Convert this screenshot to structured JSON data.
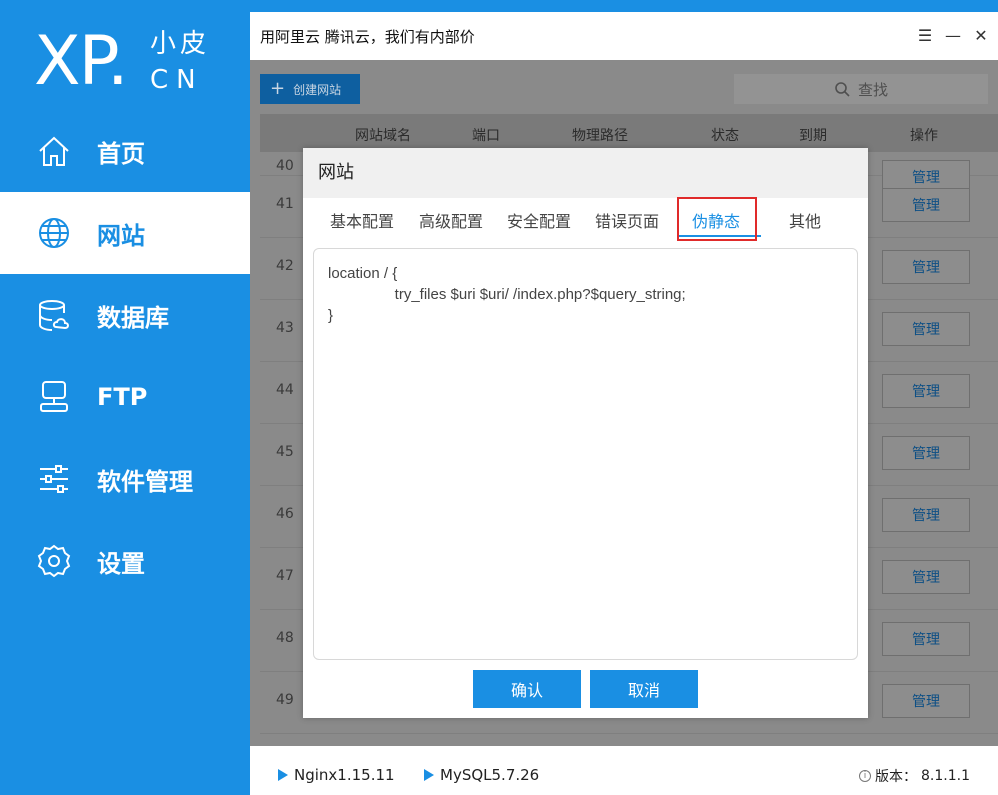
{
  "logo": {
    "main": "XP.",
    "cn_top": "小皮",
    "cn_bottom": "CN"
  },
  "nav": [
    {
      "label": "首页",
      "icon": "home-icon",
      "active": false
    },
    {
      "label": "网站",
      "icon": "globe-icon",
      "active": true
    },
    {
      "label": "数据库",
      "icon": "database-icon",
      "active": false
    },
    {
      "label": "FTP",
      "icon": "ftp-icon",
      "active": false
    },
    {
      "label": "软件管理",
      "icon": "sliders-icon",
      "active": false
    },
    {
      "label": "设置",
      "icon": "gear-icon",
      "active": false
    }
  ],
  "window": {
    "title": "用阿里云 腾讯云，我们有内部价",
    "menu_glyph": "☰",
    "minimize_glyph": "—",
    "close_glyph": "✕"
  },
  "toolbar": {
    "create_label": "创建网站",
    "search_label": "查找"
  },
  "table": {
    "headers": [
      "网站域名",
      "端口",
      "物理路径",
      "状态",
      "到期",
      "操作"
    ],
    "rows": [
      {
        "num": "40",
        "action": "管理"
      },
      {
        "num": "41",
        "action": "管理"
      },
      {
        "num": "42",
        "action": "管理"
      },
      {
        "num": "43",
        "action": "管理"
      },
      {
        "num": "44",
        "action": "管理"
      },
      {
        "num": "45",
        "action": "管理"
      },
      {
        "num": "46",
        "action": "管理"
      },
      {
        "num": "47",
        "action": "管理"
      },
      {
        "num": "48",
        "action": "管理"
      },
      {
        "num": "49",
        "action": "管理"
      }
    ]
  },
  "dialog": {
    "title": "网站",
    "tabs": [
      "基本配置",
      "高级配置",
      "安全配置",
      "错误页面",
      "伪静态",
      "其他"
    ],
    "active_tab": "伪静态",
    "code": [
      "location / {",
      "                try_files $uri $uri/ /index.php?$query_string;",
      "}"
    ],
    "confirm_label": "确认",
    "cancel_label": "取消"
  },
  "status": {
    "nginx": "Nginx1.15.11",
    "mysql": "MySQL5.7.26",
    "version_label": "版本：",
    "version": "8.1.1.1"
  },
  "colors": {
    "accent": "#1a8fe3",
    "highlight": "#e02a2a"
  }
}
